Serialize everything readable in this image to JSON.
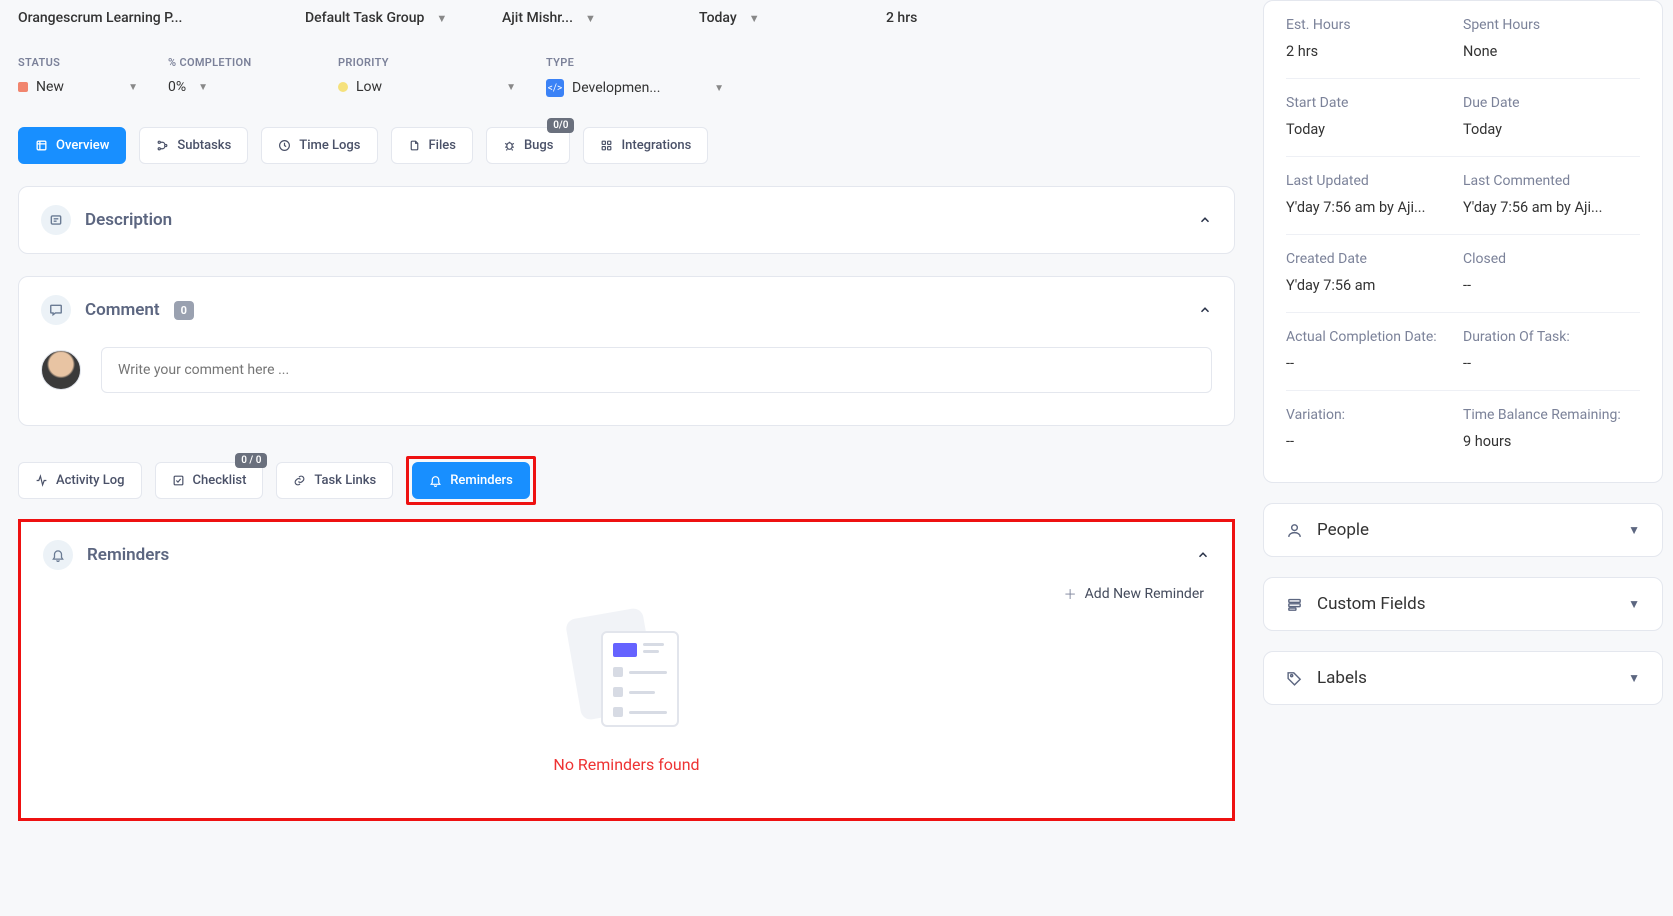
{
  "top": {
    "project": "Orangescrum Learning P...",
    "group": "Default Task Group",
    "assignee": "Ajit Mishr...",
    "due": "Today",
    "hours": "2 hrs"
  },
  "meta": {
    "status": {
      "label": "STATUS",
      "value": "New"
    },
    "completion": {
      "label": "% COMPLETION",
      "value": "0%"
    },
    "priority": {
      "label": "PRIORITY",
      "value": "Low"
    },
    "type": {
      "label": "TYPE",
      "value": "Developmen...",
      "icon": "</>"
    }
  },
  "tabs1": {
    "overview": "Overview",
    "subtasks": "Subtasks",
    "timelogs": "Time Logs",
    "files": "Files",
    "bugs": "Bugs",
    "bugs_badge": "0/0",
    "integrations": "Integrations"
  },
  "desc": {
    "title": "Description"
  },
  "comment": {
    "title": "Comment",
    "count": "0",
    "placeholder": "Write your comment here ..."
  },
  "tabs2": {
    "activity": "Activity Log",
    "checklist": "Checklist",
    "checklist_badge": "0 / 0",
    "tasklinks": "Task Links",
    "reminders": "Reminders"
  },
  "reminders": {
    "title": "Reminders",
    "add": "Add New Reminder",
    "empty": "No Reminders found"
  },
  "side": {
    "rows": [
      {
        "l1": "Est. Hours",
        "v1": "2 hrs",
        "l2": "Spent Hours",
        "v2": "None"
      },
      {
        "l1": "Start Date",
        "v1": "Today",
        "l2": "Due Date",
        "v2": "Today"
      },
      {
        "l1": "Last Updated",
        "v1": "Y'day 7:56 am by Aji...",
        "l2": "Last Commented",
        "v2": "Y'day 7:56 am by Aji..."
      },
      {
        "l1": "Created Date",
        "v1": "Y'day 7:56 am",
        "l2": "Closed",
        "v2": "--"
      },
      {
        "l1": "Actual Completion Date:",
        "v1": "--",
        "l2": "Duration Of Task:",
        "v2": "--"
      },
      {
        "l1": "Variation:",
        "v1": "--",
        "l2": "Time Balance Remaining:",
        "v2": "9 hours"
      }
    ],
    "people": "People",
    "custom": "Custom Fields",
    "labels": "Labels"
  }
}
